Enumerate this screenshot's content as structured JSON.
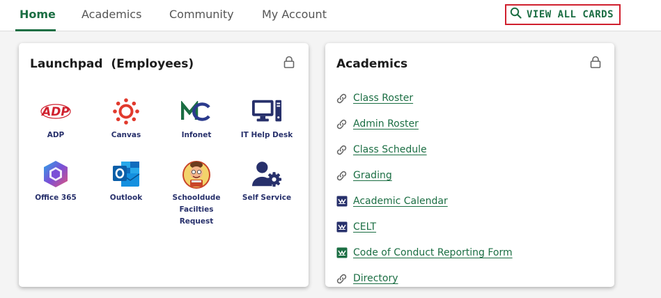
{
  "nav": {
    "tabs": [
      {
        "label": "Home",
        "active": true
      },
      {
        "label": "Academics",
        "active": false
      },
      {
        "label": "Community",
        "active": false
      },
      {
        "label": "My Account",
        "active": false
      }
    ],
    "view_all_label": "VIEW ALL CARDS",
    "view_all_icon": "search-icon"
  },
  "colors": {
    "accent_green": "#1b6e43",
    "highlight_red": "#d0202e",
    "label_navy": "#27306b"
  },
  "launchpad": {
    "title": "Launchpad  (Employees)",
    "lock_icon": "lock-icon",
    "apps": [
      {
        "label": "ADP",
        "icon": "adp-logo-icon"
      },
      {
        "label": "Canvas",
        "icon": "canvas-logo-icon"
      },
      {
        "label": "Infonet",
        "icon": "infonet-logo-icon"
      },
      {
        "label": "IT Help Desk",
        "icon": "computer-monitor-icon"
      },
      {
        "label": "Office 365",
        "icon": "office365-logo-icon"
      },
      {
        "label": "Outlook",
        "icon": "outlook-logo-icon"
      },
      {
        "label": "Schooldude Facilties Request",
        "icon": "schooldude-mascot-icon"
      },
      {
        "label": "Self Service",
        "icon": "user-gear-icon"
      }
    ]
  },
  "academics": {
    "title": "Academics",
    "lock_icon": "lock-icon",
    "links": [
      {
        "label": "Class Roster",
        "icon": "link-icon"
      },
      {
        "label": "Admin Roster",
        "icon": "link-icon"
      },
      {
        "label": "Class Schedule",
        "icon": "link-icon"
      },
      {
        "label": "Grading",
        "icon": "link-icon"
      },
      {
        "label": "Academic Calendar",
        "icon": "navy-badge-icon"
      },
      {
        "label": "CELT",
        "icon": "navy-badge-icon"
      },
      {
        "label": "Code of Conduct Reporting Form",
        "icon": "green-badge-icon"
      },
      {
        "label": "Directory",
        "icon": "link-icon"
      }
    ]
  }
}
